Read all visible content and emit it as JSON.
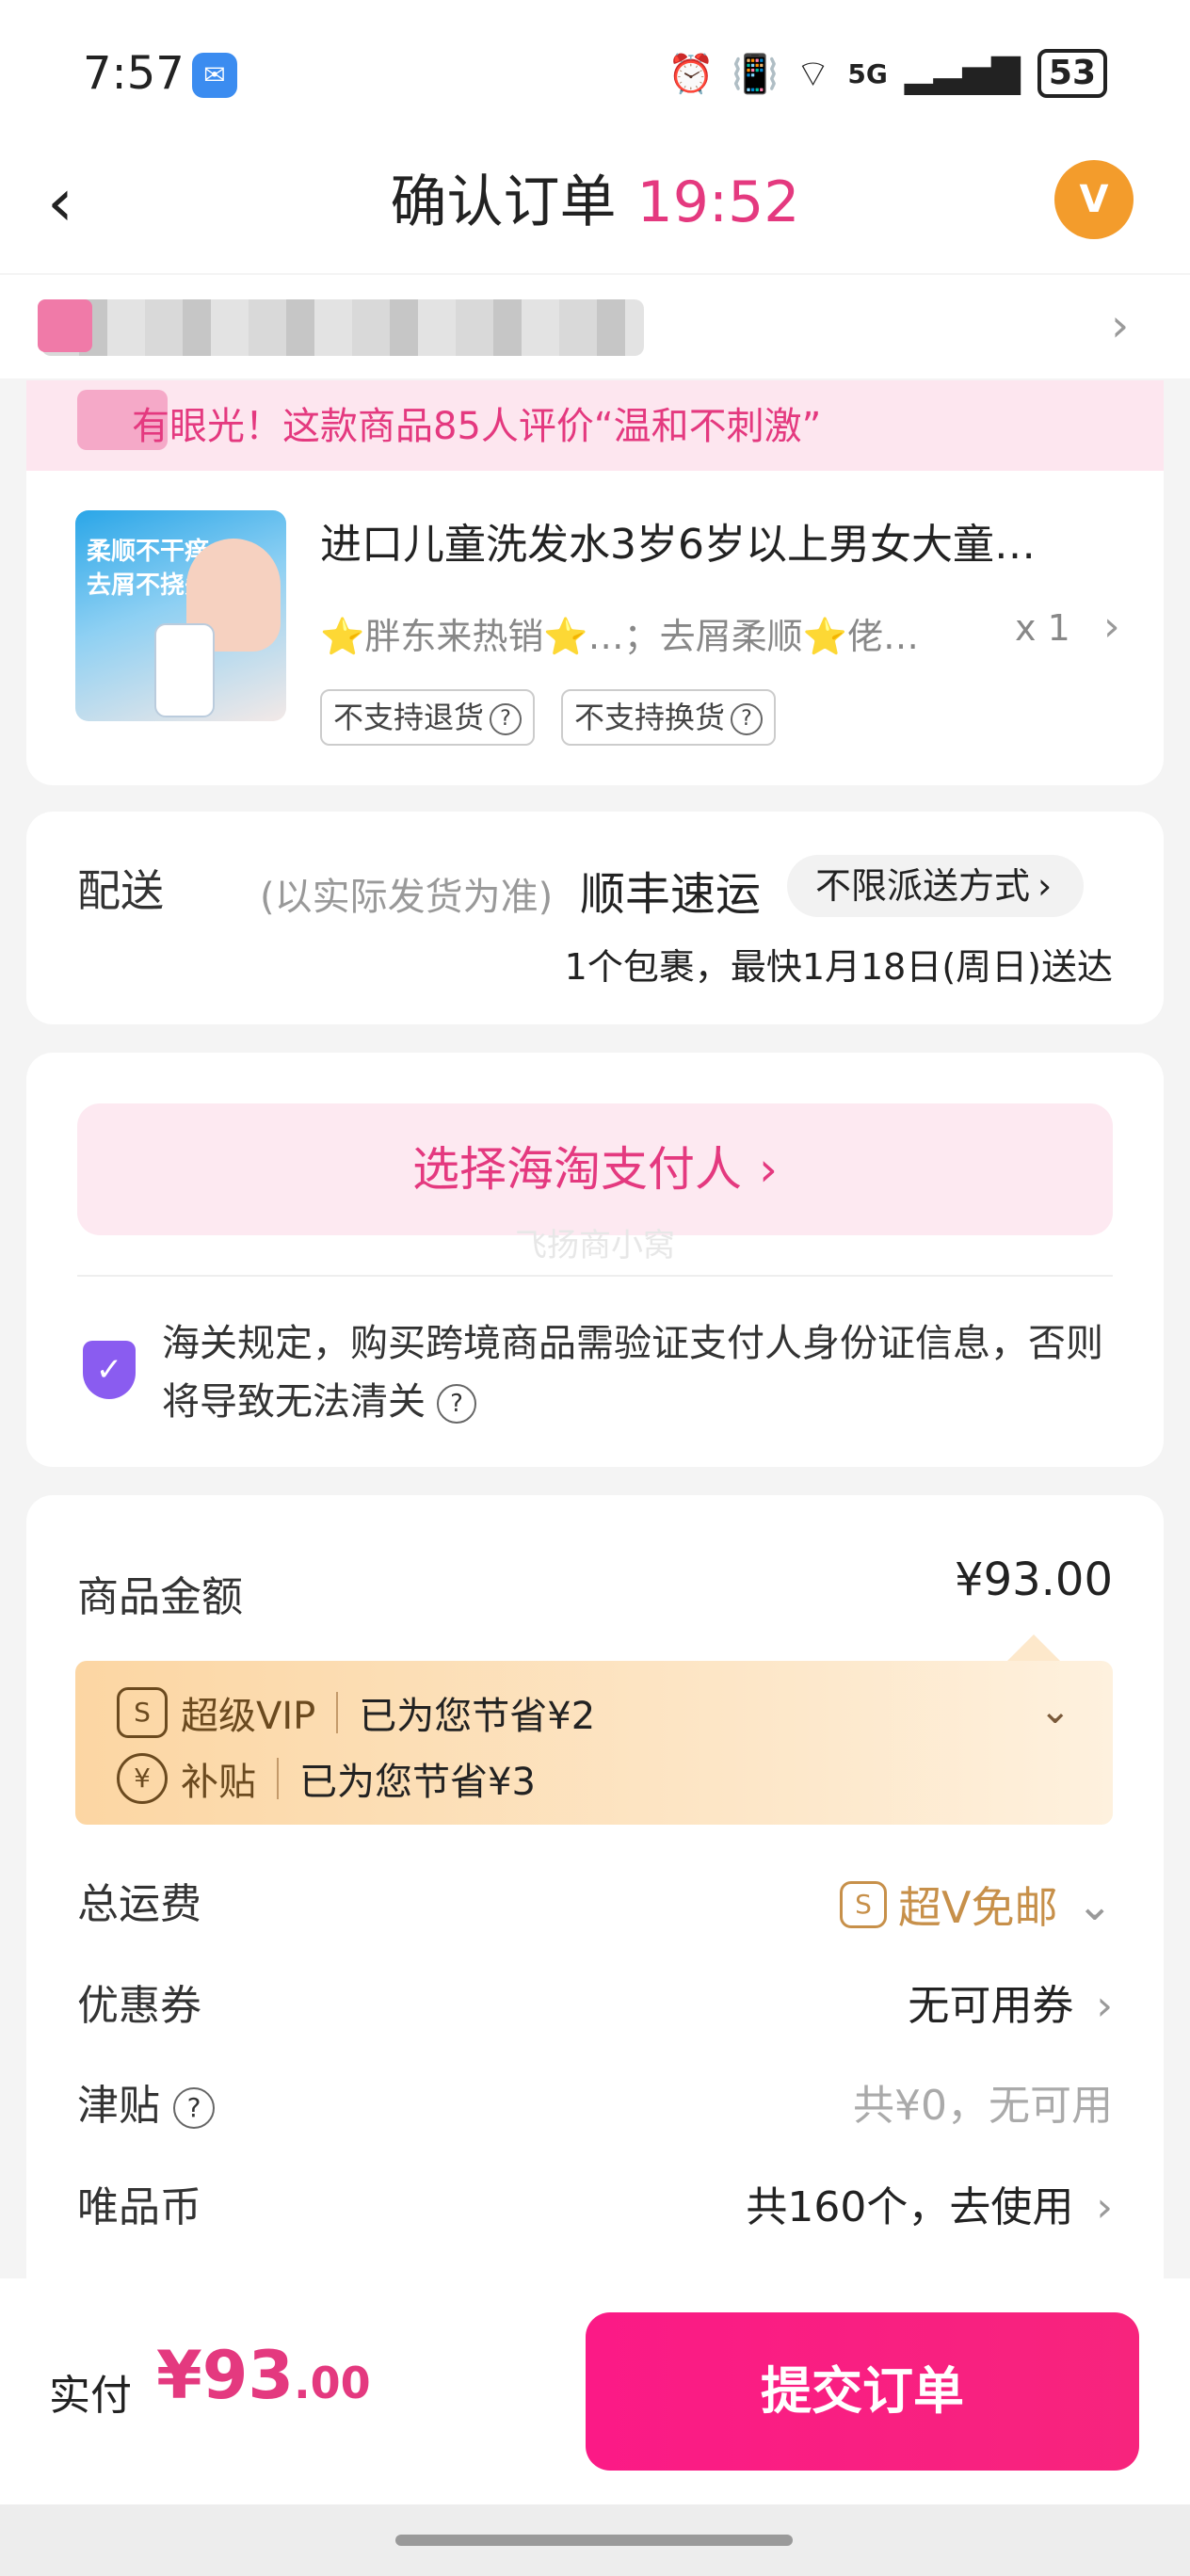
{
  "status_bar": {
    "time": "7:57",
    "message_icon": "chat-bubble",
    "net_label": "5G",
    "battery": "53"
  },
  "header": {
    "title": "确认订单",
    "countdown": "19:52",
    "service_icon": "V"
  },
  "banner": {
    "text": "有眼光！这款商品85人评价“温和不刺激”"
  },
  "product": {
    "image_tag_line1": "柔顺不干痒",
    "image_tag_line2": "去屑不挠头",
    "name": "进口儿童洗发水3岁6岁以上男女大童…",
    "spec": "⭐胖东来热销⭐…；去屑柔顺⭐佬…",
    "qty": "x 1",
    "policies": [
      "不支持退货",
      "不支持换货"
    ]
  },
  "delivery": {
    "label": "配送",
    "note": "(以实际发货为准)",
    "carrier": "顺丰速运",
    "method": "不限派送方式",
    "eta": "1个包裹，最快1月18日(周日)送达"
  },
  "payer": {
    "button": "选择海淘支付人",
    "watermark": "飞扬商小窝",
    "notice": "海关规定，购买跨境商品需验证支付人身份证信息，否则将导致无法清关"
  },
  "price": {
    "goods_label": "商品金额",
    "goods_amount": "¥93.00",
    "savings": [
      {
        "icon": "S",
        "name": "超级VIP",
        "text": "已为您节省¥2"
      },
      {
        "icon": "¥",
        "name": "补贴",
        "text": "已为您节省¥3"
      }
    ],
    "shipping_label": "总运费",
    "shipping_value": "超V免邮",
    "coupon_label": "优惠券",
    "coupon_value": "无可用券",
    "allowance_label": "津贴",
    "allowance_value": "共¥0，无可用",
    "coin_label": "唯品币",
    "coin_value": "共160个，去使用"
  },
  "footer": {
    "pay_label": "实付",
    "pay_currency": "¥",
    "pay_int": "93",
    "pay_dec": ".00",
    "submit": "提交订单"
  },
  "colors": {
    "accent": "#e4397f",
    "submit": "#fb1a86",
    "gold": "#c7904a"
  }
}
